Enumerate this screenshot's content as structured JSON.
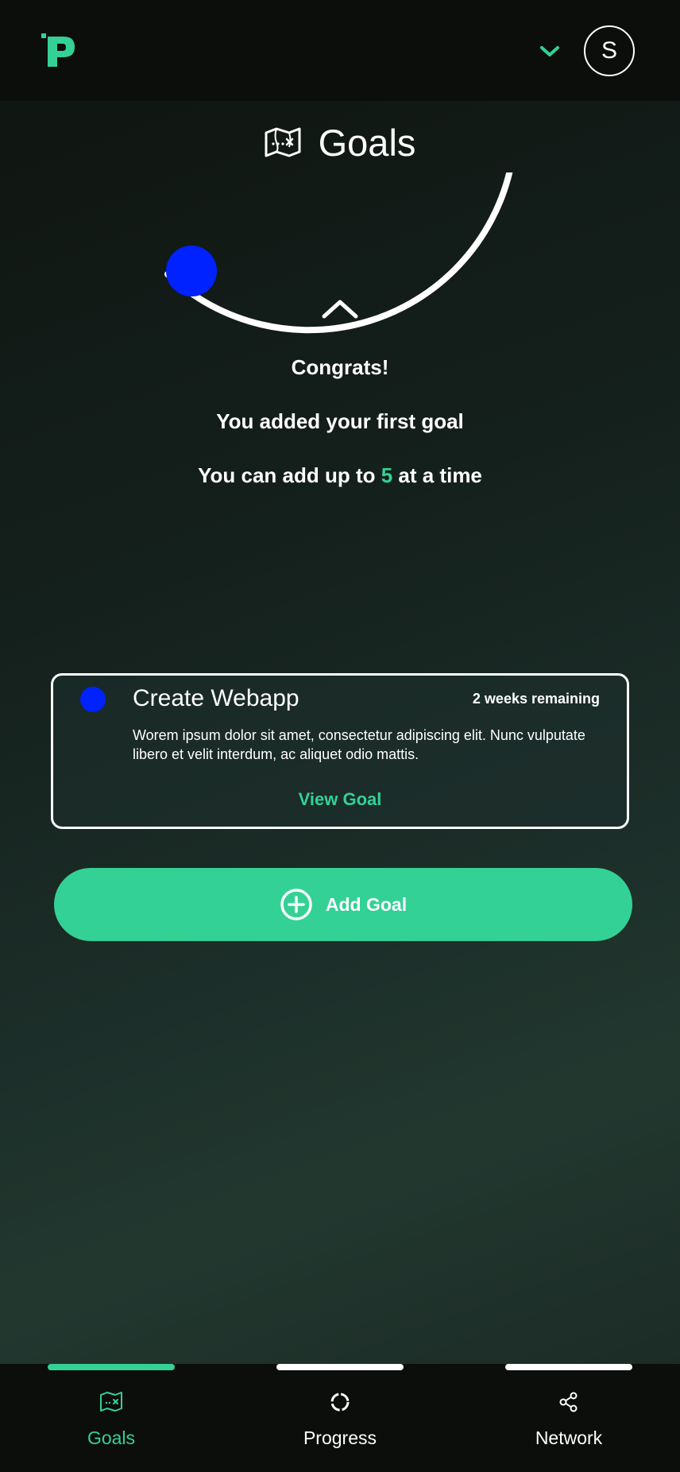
{
  "header": {
    "logo_icon": "p-logo-icon",
    "menu_icon": "chevron-down-icon",
    "avatar_initial": "S"
  },
  "page": {
    "title": "Goals",
    "title_icon": "map-icon"
  },
  "messages": {
    "congrats": "Congrats!",
    "first_goal": "You added your first goal",
    "limit_prefix": "You can add up to ",
    "limit_number": "5",
    "limit_suffix": " at a time"
  },
  "goal_card": {
    "title": "Create Webapp",
    "remaining": "2 weeks remaining",
    "description": "Worem ipsum dolor sit amet, consectetur adipiscing elit. Nunc vulputate libero et velit interdum, ac aliquet odio mattis.",
    "action_label": "View Goal",
    "dot_color": "#0022ff"
  },
  "add_goal": {
    "label": "Add Goal",
    "icon": "plus-circle-icon"
  },
  "nav": {
    "items": [
      {
        "label": "Goals",
        "icon": "map-icon",
        "active": true
      },
      {
        "label": "Progress",
        "icon": "progress-ring-icon",
        "active": false
      },
      {
        "label": "Network",
        "icon": "share-icon",
        "active": false
      }
    ]
  },
  "colors": {
    "accent": "#33d196",
    "goal_dot": "#0022ff",
    "background": "#0c0e0c"
  }
}
